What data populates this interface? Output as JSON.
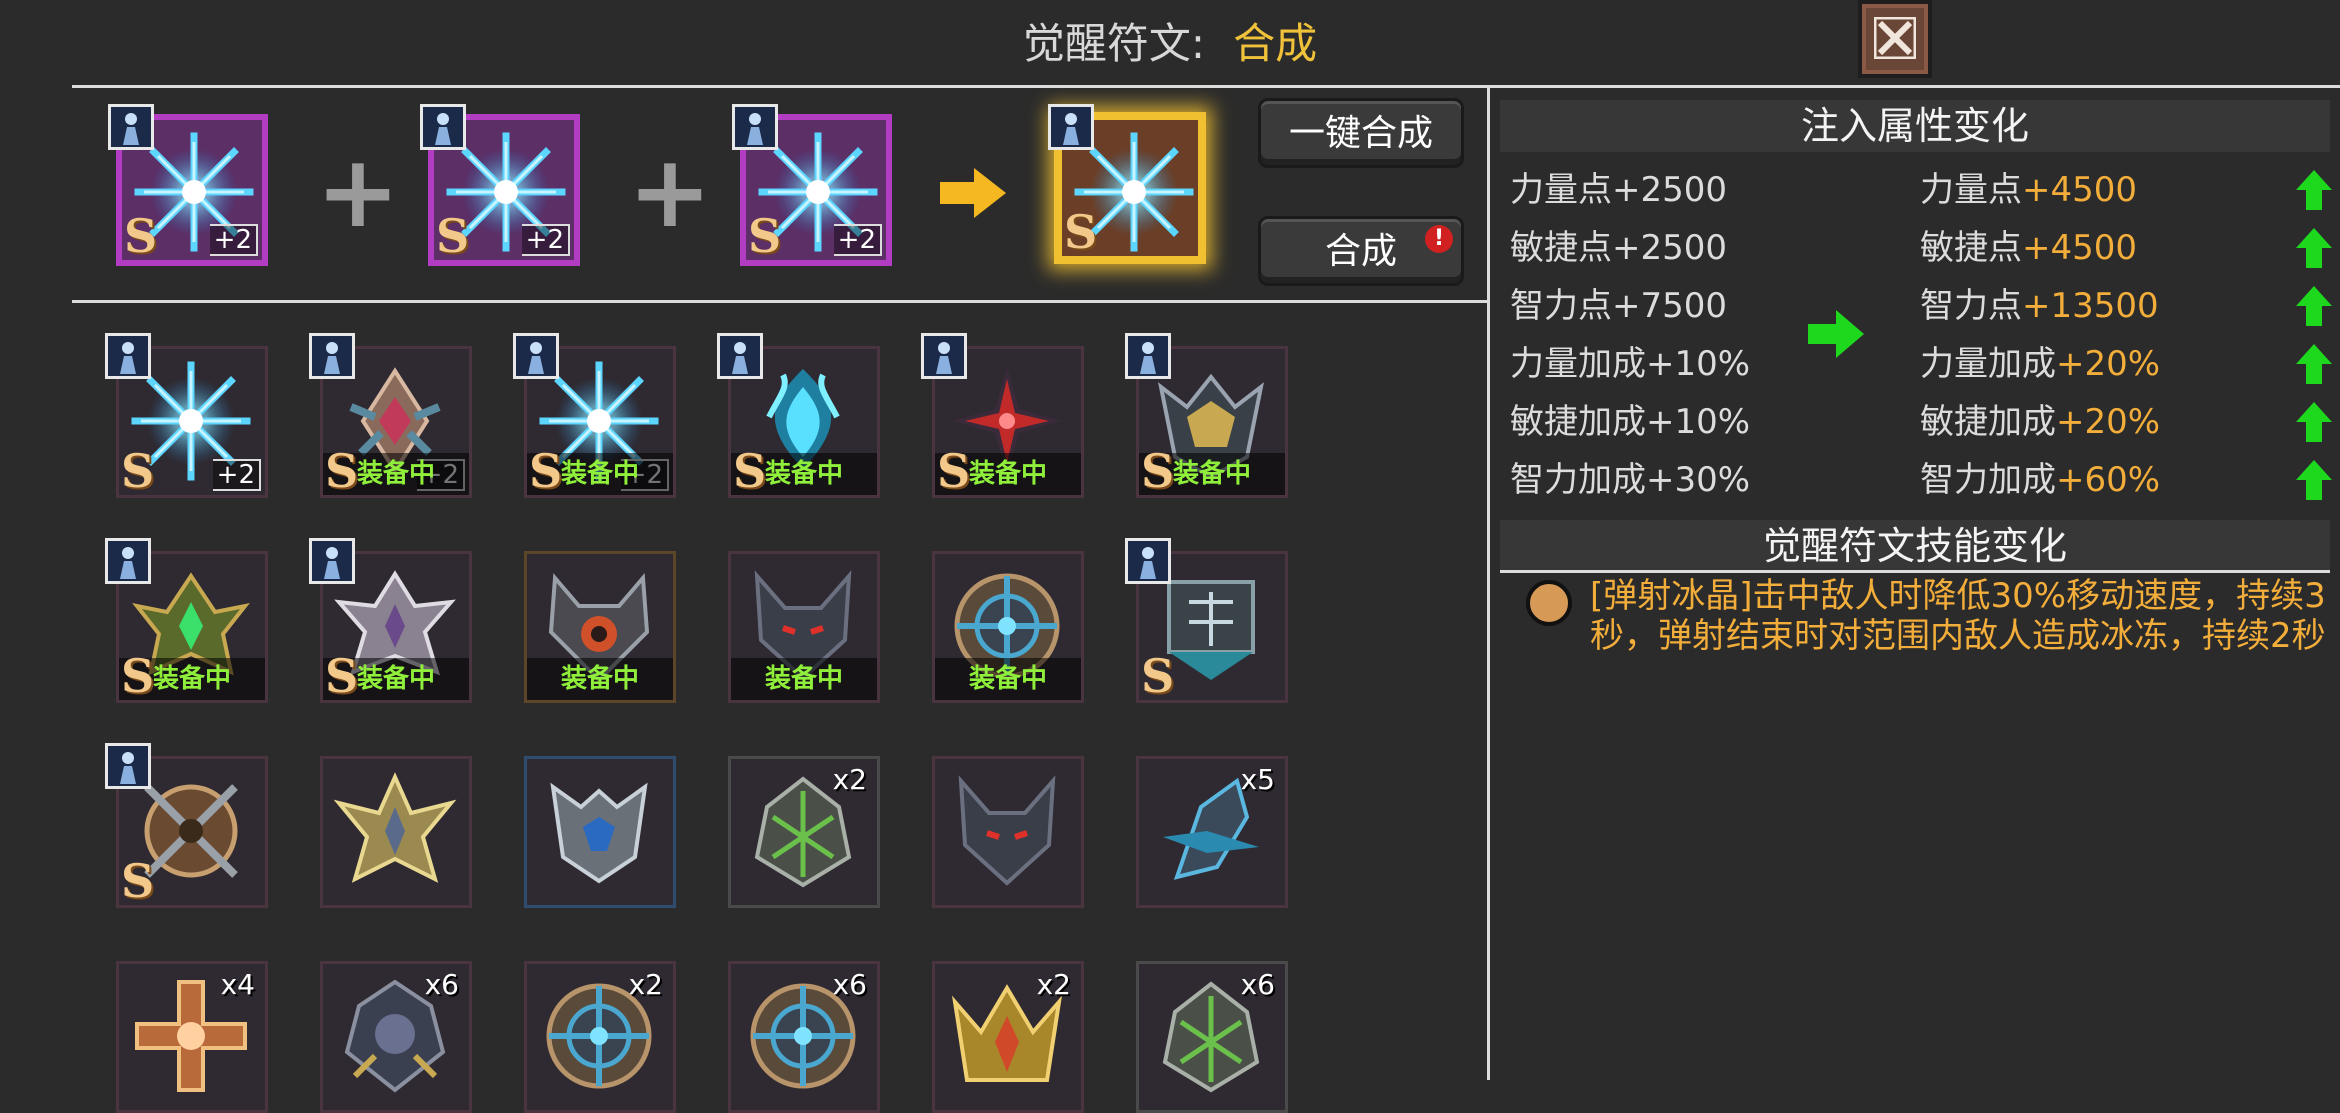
{
  "header": {
    "title": "觉醒符文:",
    "mode": "合成"
  },
  "synthesis": {
    "inputs": [
      {
        "grade": "S",
        "level": "+2"
      },
      {
        "grade": "S",
        "level": "+2"
      },
      {
        "grade": "S",
        "level": "+2"
      }
    ],
    "output": {
      "grade": "S"
    },
    "plus_symbol": "+",
    "one_click_label": "一键合成",
    "synth_label": "合成",
    "synth_badge": "!"
  },
  "inventory": {
    "equipped_label": "装备中",
    "rows": [
      [
        {
          "grade": "S",
          "level": "+2",
          "equipped": false,
          "portrait": true,
          "art": "ice"
        },
        {
          "grade": "S",
          "level": "+2",
          "equipped": true,
          "portrait": true,
          "art": "diamond"
        },
        {
          "grade": "S",
          "level": "+2",
          "equipped": true,
          "portrait": true,
          "art": "ice"
        },
        {
          "grade": "S",
          "equipped": true,
          "portrait": true,
          "art": "flame"
        },
        {
          "grade": "S",
          "equipped": true,
          "portrait": true,
          "art": "red"
        },
        {
          "grade": "S",
          "equipped": true,
          "portrait": true,
          "art": "helm"
        }
      ],
      [
        {
          "grade": "S",
          "equipped": true,
          "portrait": true,
          "art": "green"
        },
        {
          "grade": "S",
          "equipped": true,
          "portrait": true,
          "art": "silver"
        },
        {
          "equipped": true,
          "art": "demon"
        },
        {
          "equipped": true,
          "art": "wolf"
        },
        {
          "equipped": true,
          "art": "wheel"
        },
        {
          "grade": "S",
          "equipped": false,
          "portrait": true,
          "art": "gate"
        }
      ],
      [
        {
          "grade": "S",
          "portrait": true,
          "art": "shield"
        },
        {
          "art": "gold"
        },
        {
          "art": "steel"
        },
        {
          "count": "x2",
          "art": "leaf"
        },
        {
          "art": "wolf"
        },
        {
          "count": "x5",
          "art": "shard"
        }
      ],
      [
        {
          "count": "x4",
          "art": "cross"
        },
        {
          "count": "x6",
          "art": "dark"
        },
        {
          "count": "x2",
          "art": "wheel"
        },
        {
          "count": "x6",
          "art": "wheel"
        },
        {
          "count": "x2",
          "art": "crown"
        },
        {
          "count": "x6",
          "art": "leaf"
        }
      ]
    ]
  },
  "stats_panel": {
    "title": "注入属性变化",
    "rows": [
      {
        "old_label": "力量点",
        "old_value": "+2500",
        "new_label": "力量点",
        "new_value": "+4500"
      },
      {
        "old_label": "敏捷点",
        "old_value": "+2500",
        "new_label": "敏捷点",
        "new_value": "+4500"
      },
      {
        "old_label": "智力点",
        "old_value": "+7500",
        "new_label": "智力点",
        "new_value": "+13500"
      },
      {
        "old_label": "力量加成",
        "old_value": "+10%",
        "new_label": "力量加成",
        "new_value": "+20%"
      },
      {
        "old_label": "敏捷加成",
        "old_value": "+10%",
        "new_label": "敏捷加成",
        "new_value": "+20%"
      },
      {
        "old_label": "智力加成",
        "old_value": "+30%",
        "new_label": "智力加成",
        "new_value": "+60%"
      }
    ]
  },
  "skill_panel": {
    "title": "觉醒符文技能变化",
    "description": "[弹射冰晶]击中敌人时降低30%移动速度，持续3秒，弹射结束时对范围内敌人造成冰冻，持续2秒"
  },
  "colors": {
    "background": "#2b2b2b",
    "gold_accent": "#f0c23a",
    "equipped_green": "#8fef3a",
    "up_green": "#1ed81e",
    "new_value_orange": "#f2ad3a"
  }
}
